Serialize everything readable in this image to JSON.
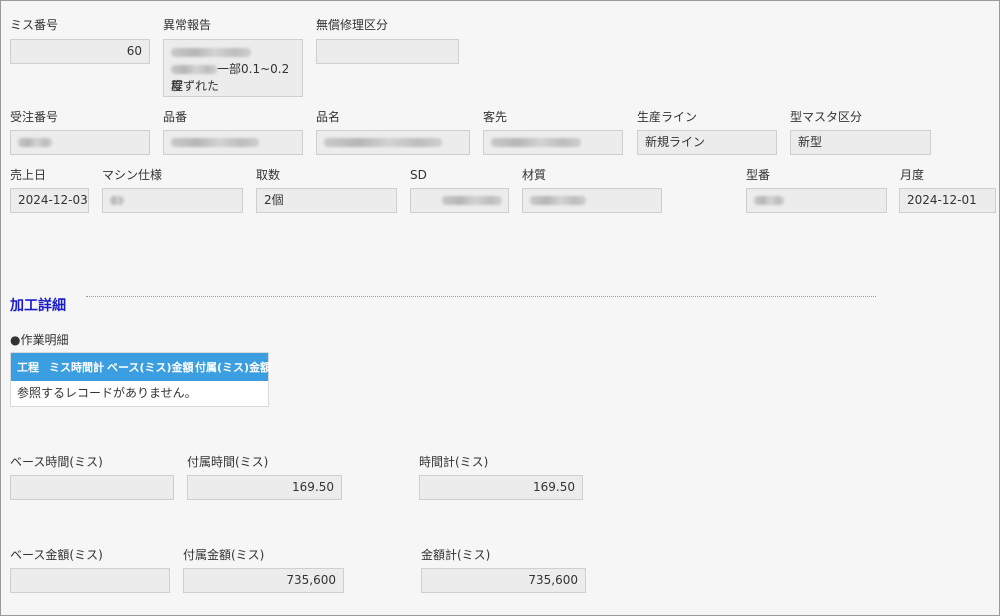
{
  "row1": {
    "miss_no": {
      "label": "ミス番号",
      "value": "60"
    },
    "abnormal": {
      "label": "異常報告",
      "line2": "一部0.1~0.2程",
      "line3": "度ずれた"
    },
    "free_repair": {
      "label": "無償修理区分",
      "value": ""
    }
  },
  "row2": {
    "order_no": {
      "label": "受注番号"
    },
    "part_no": {
      "label": "品番"
    },
    "part_name": {
      "label": "品名"
    },
    "customer": {
      "label": "客先"
    },
    "line": {
      "label": "生産ライン",
      "value": "新規ライン"
    },
    "mold_master": {
      "label": "型マスタ区分",
      "value": "新型"
    }
  },
  "row3": {
    "sales_date": {
      "label": "売上日",
      "value": "2024-12-03"
    },
    "machine": {
      "label": "マシン仕様"
    },
    "count": {
      "label": "取数",
      "value": "2個"
    },
    "sd": {
      "label": "SD"
    },
    "material": {
      "label": "材質"
    },
    "model_no": {
      "label": "型番"
    },
    "month": {
      "label": "月度",
      "value": "2024-12-01"
    }
  },
  "section": {
    "title": "加工詳細",
    "subtitle": "●作業明細",
    "table": {
      "headers": [
        "工程",
        "ミス時間計",
        "ベース(ミス)金額",
        "付属(ミス)金額"
      ],
      "empty_message": "参照するレコードがありません。"
    }
  },
  "times": {
    "base": {
      "label": "ベース時間(ミス)",
      "value": ""
    },
    "attach": {
      "label": "付属時間(ミス)",
      "value": "169.50"
    },
    "total": {
      "label": "時間計(ミス)",
      "value": "169.50"
    }
  },
  "amounts": {
    "base": {
      "label": "ベース金額(ミス)",
      "value": ""
    },
    "attach": {
      "label": "付属金額(ミス)",
      "value": "735,600"
    },
    "total": {
      "label": "金額計(ミス)",
      "value": "735,600"
    }
  }
}
